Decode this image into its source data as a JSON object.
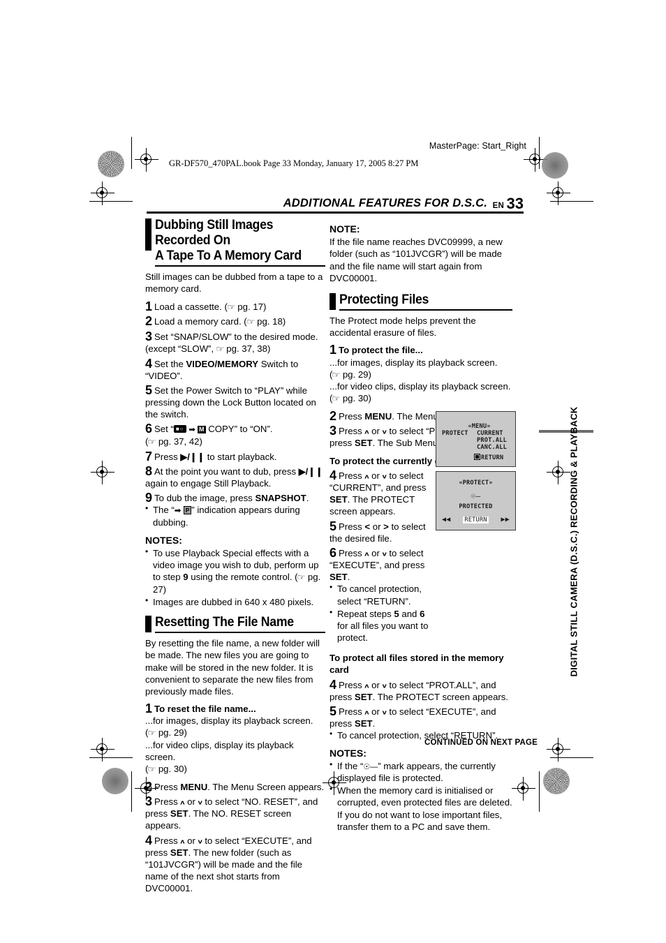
{
  "page": {
    "masterpage": "MasterPage: Start_Right",
    "filestamp": "GR-DF570_470PAL.book  Page 33  Monday, January 17, 2005  8:27 PM",
    "running_head": "ADDITIONAL FEATURES FOR D.S.C.",
    "lang_code": "EN",
    "page_number": "33",
    "side_tab": "DIGITAL STILL CAMERA (D.S.C.) RECORDING & PLAYBACK",
    "footer": "CONTINUED ON NEXT PAGE"
  },
  "left_column": {
    "section1": {
      "heading_line1": "Dubbing Still Images Recorded On",
      "heading_line2": "A Tape To A Memory Card",
      "intro": "Still images can be dubbed from a tape to a memory card.",
      "steps": [
        {
          "num": "1",
          "text": "Load a cassette. (",
          "ref": "pg. 17",
          "tail": ")"
        },
        {
          "num": "2",
          "text": "Load a memory card. (",
          "ref": "pg. 18",
          "tail": ")"
        },
        {
          "num": "3",
          "text": "Set “SNAP/SLOW” to the desired mode.",
          "cont_pre": "(except “SLOW”, ",
          "ref": "pg. 37, 38",
          "tail": ")"
        },
        {
          "num": "4",
          "pre": "Set the ",
          "bold": "VIDEO/MEMORY",
          "post": " Switch to “VIDEO”."
        },
        {
          "num": "5",
          "text": "Set the Power Switch to “PLAY” while pressing down the Lock Button located on the switch."
        },
        {
          "num": "6",
          "pre": "Set “",
          "post": " COPY” to “ON”.",
          "cont_pre": "(",
          "ref": "pg. 37, 42",
          "tail": ")"
        },
        {
          "num": "7",
          "pre": "Press ",
          "key": "▶/❙❙",
          "post": " to start playback."
        },
        {
          "num": "8",
          "pre": "At the point you want to dub, press ",
          "key": "▶/❙❙",
          "post": " again to engage Still Playback."
        },
        {
          "num": "9",
          "pre": "To dub the image, press ",
          "bold": "SNAPSHOT",
          "post": "."
        }
      ],
      "step9_bullet_pre": "The “",
      "step9_bullet_post": "” indication appears during dubbing.",
      "notes_title": "NOTES:",
      "notes": [
        {
          "pre": "To use Playback Special effects with a video image you wish to dub, perform up to step ",
          "bold": "9",
          "post": " using the remote control. (",
          "ref": "pg. 27",
          "tail": ")"
        },
        {
          "pre": "Images are dubbed in 640 x 480 pixels."
        }
      ]
    },
    "section2": {
      "heading": "Resetting The File Name",
      "intro": "By resetting the file name, a new folder will be made. The new files you are going to make will be stored in the new folder. It is convenient to separate the new files from previously made files.",
      "step1_num": "1",
      "step1_bold": "To reset the file name...",
      "step1_l1": "...for images, display its playback screen.",
      "step1_l1_ref": "pg. 29",
      "step1_l2": "...for video clips, display its playback screen.",
      "step1_l2_ref": "pg. 30",
      "step2_num": "2",
      "step2_pre": "Press ",
      "step2_bold": "MENU",
      "step2_post": ". The Menu Screen appears.",
      "step3_num": "3",
      "step3_a": "Press ",
      "step3_b": " or ",
      "step3_c": " to select “NO. RESET”, and press ",
      "step3_bold": "SET",
      "step3_d": ". The NO. RESET screen appears.",
      "step4_num": "4",
      "step4_a": "Press ",
      "step4_b": " or ",
      "step4_c": " to select “EXECUTE”, and press ",
      "step4_bold": "SET",
      "step4_d": ". The new folder (such as “101JVCGR”) will be made and the file name of the next shot starts from DVC00001."
    }
  },
  "right_column": {
    "note_title": "NOTE:",
    "note_text": "If the file name reaches DVC09999, a new folder (such as “101JVCGR”) will be made and the file name will start again from DVC00001.",
    "section": {
      "heading": "Protecting Files",
      "intro": "The Protect mode helps prevent the accidental erasure of files.",
      "step1_num": "1",
      "step1_bold": "To protect the file...",
      "step1_l1": "...for images, display its playback screen.",
      "step1_l1_ref": "pg. 29",
      "step1_l2": "...for video clips, display its playback screen.",
      "step1_l2_ref": "pg. 30",
      "step2_num": "2",
      "step2_pre": "Press ",
      "step2_bold": "MENU",
      "step2_post": ". The Menu Screen appears.",
      "step3_num": "3",
      "step3_a": "Press ",
      "step3_b": " or ",
      "step3_c": " to select “PROTECT”, and press ",
      "step3_bold": "SET",
      "step3_d": ". The Sub Menu appears.",
      "subhead_current": "To protect the currently displayed file",
      "step4_num": "4",
      "step4_a": "Press ",
      "step4_b": " or ",
      "step4_c": " to select “CURRENT”, and press ",
      "step4_bold": "SET",
      "step4_d": ". The PROTECT screen appears.",
      "step5_num": "5",
      "step5_a": "Press ",
      "step5_lt": "<",
      "step5_b": " or ",
      "step5_gt": ">",
      "step5_c": " to select the desired file.",
      "step6_num": "6",
      "step6_a": "Press ",
      "step6_b": " or ",
      "step6_c": " to select “EXECUTE”, and press ",
      "step6_bold": "SET",
      "step6_d": ".",
      "step6_bullets": [
        {
          "pre": "To cancel protection, select “RETURN”."
        },
        {
          "pre": "Repeat steps ",
          "bold1": "5",
          "mid": " and ",
          "bold2": "6",
          "post": " for all files you want to protect."
        }
      ],
      "subhead_all": "To protect all files stored in the memory card",
      "all_step4_num": "4",
      "all_step4_a": "Press ",
      "all_step4_b": " or ",
      "all_step4_c": " to select “PROT.ALL”, and press ",
      "all_step4_bold": "SET",
      "all_step4_d": ". The PROTECT screen appears.",
      "all_step5_num": "5",
      "all_step5_a": "Press ",
      "all_step5_b": " or ",
      "all_step5_c": " to select “EXECUTE”, and press ",
      "all_step5_bold": "SET",
      "all_step5_d": ".",
      "all_step5_bullet": "To cancel protection, select “RETURN”.",
      "notes_title": "NOTES:",
      "notes": [
        {
          "pre": "If the “",
          "post": "” mark appears, the currently displayed file is protected."
        },
        {
          "pre": "When the memory card is initialised or corrupted, even protected files are deleted. If you do not want to lose important files, transfer them to a PC and save them."
        }
      ]
    },
    "lcd_menu": {
      "title": "«MENU»",
      "label": "PROTECT",
      "items": [
        "CURRENT",
        "PROT.ALL",
        "CANC.ALL"
      ],
      "return": "RETURN"
    },
    "lcd_protect": {
      "title": "«PROTECT»",
      "status": "PROTECTED",
      "return": "RETURN",
      "rew": "◀◀",
      "ff": "▶▶"
    }
  },
  "icons": {
    "pointing_hand": "☞",
    "arrow_right": "➡",
    "up_key": "ʌ",
    "down_key": "v",
    "tape": "▬",
    "memory": "M",
    "p_mark": "P",
    "key_lock": "☸"
  }
}
